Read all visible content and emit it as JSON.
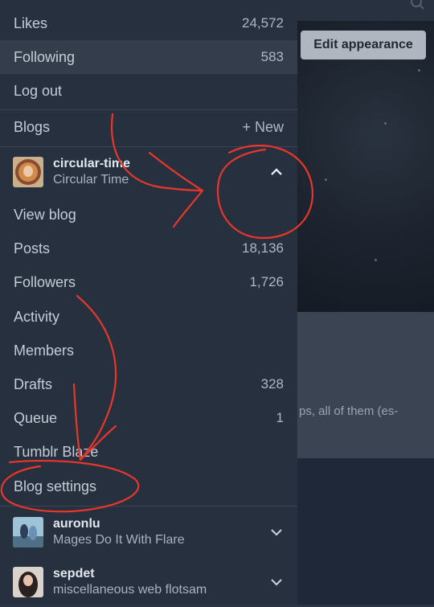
{
  "background": {
    "edit_appearance_label": "Edit appearance",
    "card_text": "ps, all of them (es-"
  },
  "menu": {
    "top_items": [
      {
        "label": "Likes",
        "count": "24,572"
      },
      {
        "label": "Following",
        "count": "583"
      },
      {
        "label": "Log out",
        "count": ""
      }
    ],
    "blogs_header": {
      "label": "Blogs",
      "new_label": "+ New"
    },
    "current_blog": {
      "name": "circular-time",
      "title": "Circular Time"
    },
    "blog_menu": [
      {
        "label": "View blog",
        "count": ""
      },
      {
        "label": "Posts",
        "count": "18,136"
      },
      {
        "label": "Followers",
        "count": "1,726"
      },
      {
        "label": "Activity",
        "count": ""
      },
      {
        "label": "Members",
        "count": ""
      },
      {
        "label": "Drafts",
        "count": "328"
      },
      {
        "label": "Queue",
        "count": "1"
      },
      {
        "label": "Tumblr Blaze",
        "count": ""
      },
      {
        "label": "Blog settings",
        "count": ""
      }
    ],
    "other_blogs": [
      {
        "name": "auronlu",
        "title": "Mages Do It With Flare"
      },
      {
        "name": "sepdet",
        "title": "miscellaneous web flotsam"
      }
    ]
  },
  "colors": {
    "panel": "#26303f",
    "active_row": "#333d4b",
    "annotation": "#e8372a"
  },
  "icons": [
    "search-icon",
    "chevron-up-icon",
    "chevron-down-icon"
  ]
}
